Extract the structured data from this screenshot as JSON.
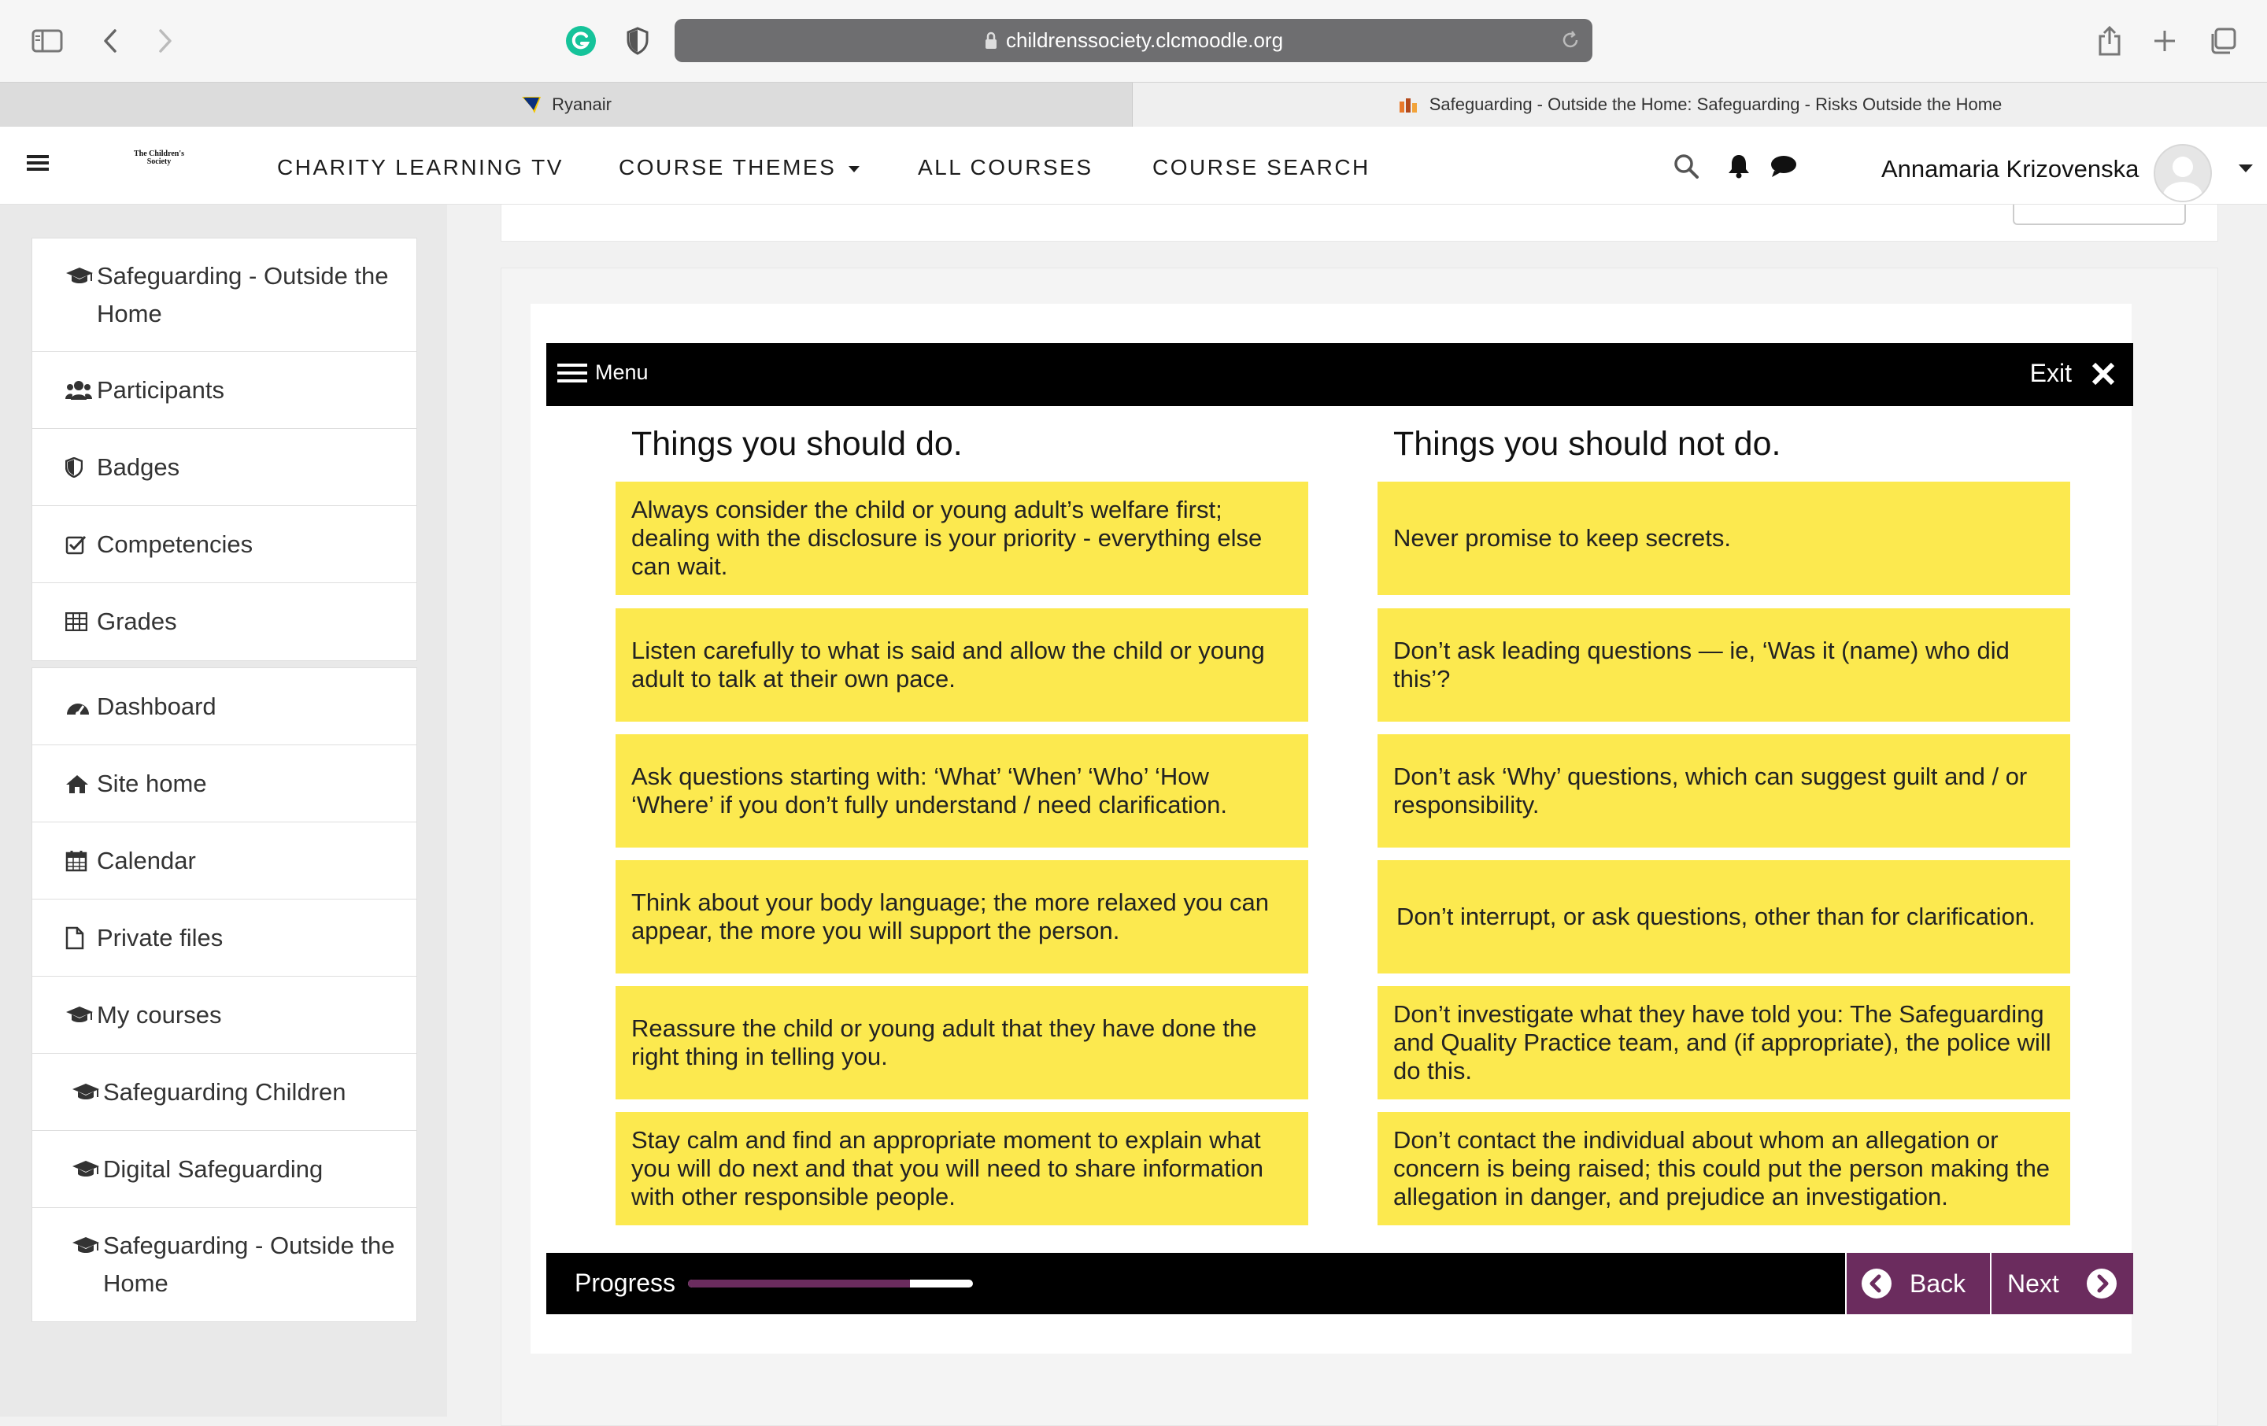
{
  "browser": {
    "url": "childrenssociety.clcmoodle.org",
    "tabs": [
      {
        "label": "Ryanair",
        "active": false
      },
      {
        "label": "Safeguarding - Outside the Home: Safeguarding - Risks Outside the Home",
        "active": true
      }
    ]
  },
  "navbar": {
    "logo_text": "The Children's Society",
    "links": [
      "CHARITY LEARNING TV",
      "COURSE THEMES",
      "ALL COURSES",
      "COURSE SEARCH"
    ],
    "user_name": "Annamaria Krizovenska"
  },
  "sidebar": {
    "course_block": [
      {
        "label": "Safeguarding - Outside the Home",
        "icon": "graduation-cap-icon"
      },
      {
        "label": "Participants",
        "icon": "users-icon"
      },
      {
        "label": "Badges",
        "icon": "shield-icon"
      },
      {
        "label": "Competencies",
        "icon": "check-square-icon"
      },
      {
        "label": "Grades",
        "icon": "table-icon"
      }
    ],
    "site_block": [
      {
        "label": "Dashboard",
        "icon": "dashboard-icon"
      },
      {
        "label": "Site home",
        "icon": "home-icon"
      },
      {
        "label": "Calendar",
        "icon": "calendar-icon"
      },
      {
        "label": "Private files",
        "icon": "file-icon"
      },
      {
        "label": "My courses",
        "icon": "graduation-cap-icon"
      },
      {
        "label": "Safeguarding Children",
        "icon": "graduation-cap-icon"
      },
      {
        "label": "Digital Safeguarding",
        "icon": "graduation-cap-icon"
      },
      {
        "label": "Safeguarding - Outside the Home",
        "icon": "graduation-cap-icon"
      }
    ]
  },
  "player": {
    "menu_label": "Menu",
    "exit_label": "Exit",
    "do_heading": "Things you should do.",
    "dont_heading": "Things you should not do.",
    "do_items": [
      "Always consider the child or young adult’s welfare first; dealing with the disclosure is your priority - everything else can wait.",
      "Listen carefully to what is said and allow the child or young adult to talk at their own pace.",
      "Ask questions starting with: ‘What’ ‘When’ ‘Who’ ‘How ‘Where’ if you don’t fully understand / need clarification.",
      "Think about your body language; the more relaxed you can appear, the more you will support the person.",
      "Reassure the child or young adult that they have done the right thing in telling you.",
      "Stay calm and find an appropriate moment to explain what you will do next and that you will need to share information with other responsible people."
    ],
    "dont_items": [
      "Never promise to keep secrets.",
      "Don’t ask leading questions — ie, ‘Was it (name) who did this’?",
      "Don’t ask ‘Why’ questions, which can suggest guilt and / or responsibility.",
      "Don’t interrupt, or ask questions, other than for clarification.",
      "Don’t investigate what they have told you: The Safeguarding and Quality Practice team, and (if appropriate), the police will do this.",
      "Don’t contact the individual about whom an allegation or concern is being raised; this could put the person making the allegation in danger, and prejudice an investigation."
    ],
    "progress_label": "Progress",
    "progress_fraction": 0.78,
    "back_label": "Back",
    "next_label": "Next"
  },
  "colors": {
    "card": "#fce94f",
    "accent": "#6b2c5e",
    "bar": "#000000"
  }
}
